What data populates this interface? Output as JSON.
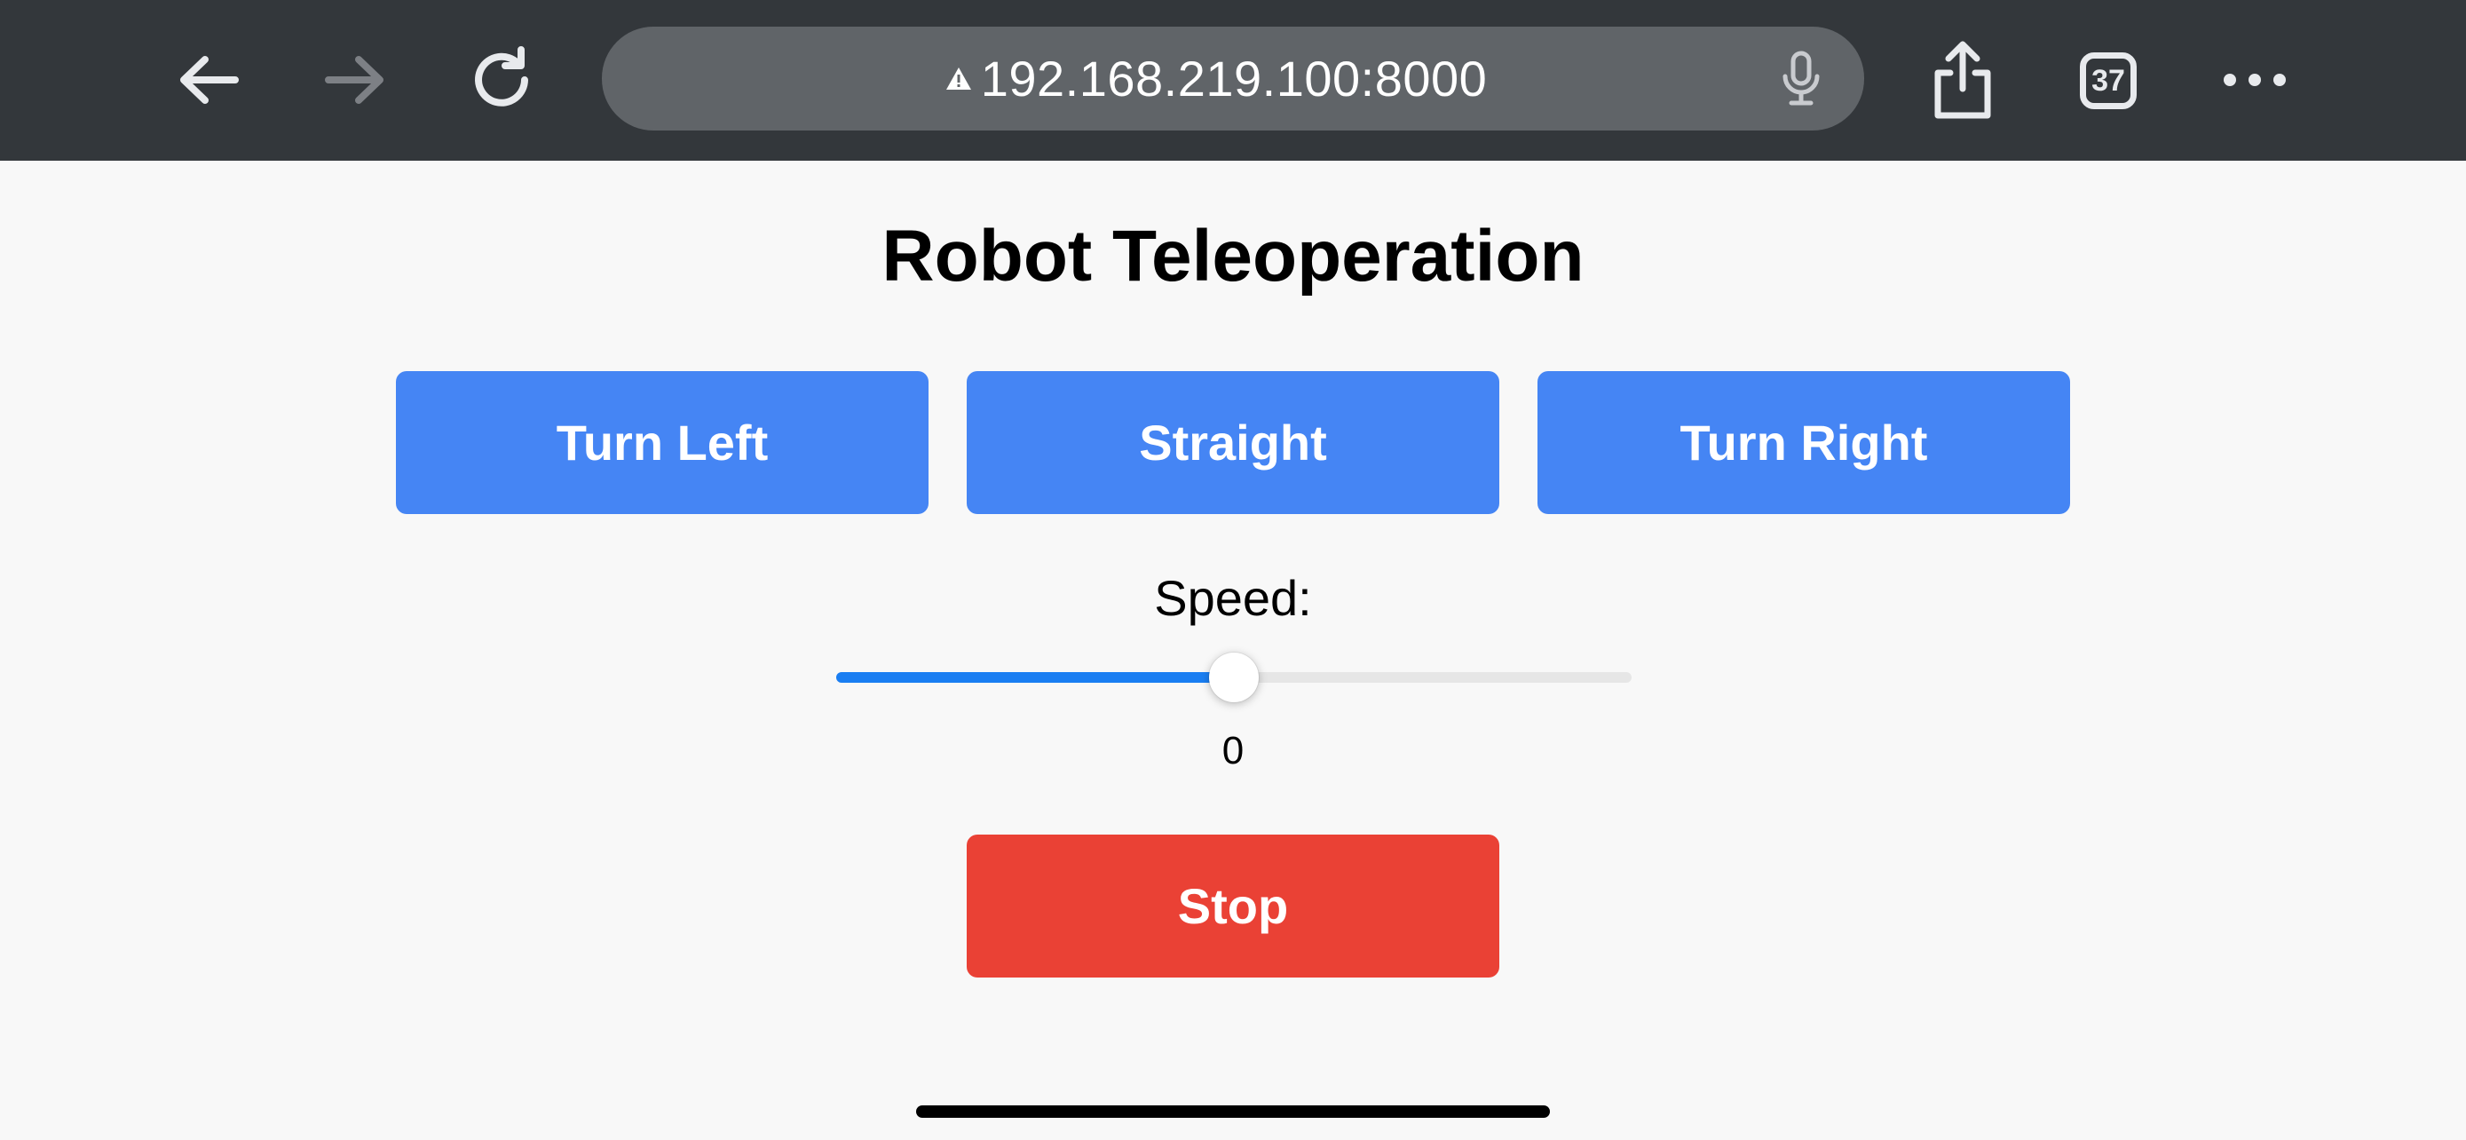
{
  "browser": {
    "url": "192.168.219.100:8000",
    "tab_count": "37",
    "icons": {
      "back": "arrow-left-icon",
      "forward": "arrow-right-icon",
      "reload": "reload-icon",
      "warning": "warning-icon",
      "mic": "microphone-icon",
      "share": "share-icon",
      "tabs": "tabs-icon",
      "more": "more-icon"
    }
  },
  "page": {
    "title": "Robot Teleoperation",
    "buttons": {
      "turn_left": "Turn Left",
      "straight": "Straight",
      "turn_right": "Turn Right",
      "stop": "Stop"
    },
    "speed": {
      "label": "Speed:",
      "value": "0",
      "slider_fraction": 0.5
    }
  },
  "colors": {
    "toolbar_bg": "#33373b",
    "address_bar_bg": "#606468",
    "page_bg": "#f8f8f8",
    "control_button": "#4585f4",
    "stop_button": "#ea4135",
    "slider_fill": "#1a7ef2"
  }
}
